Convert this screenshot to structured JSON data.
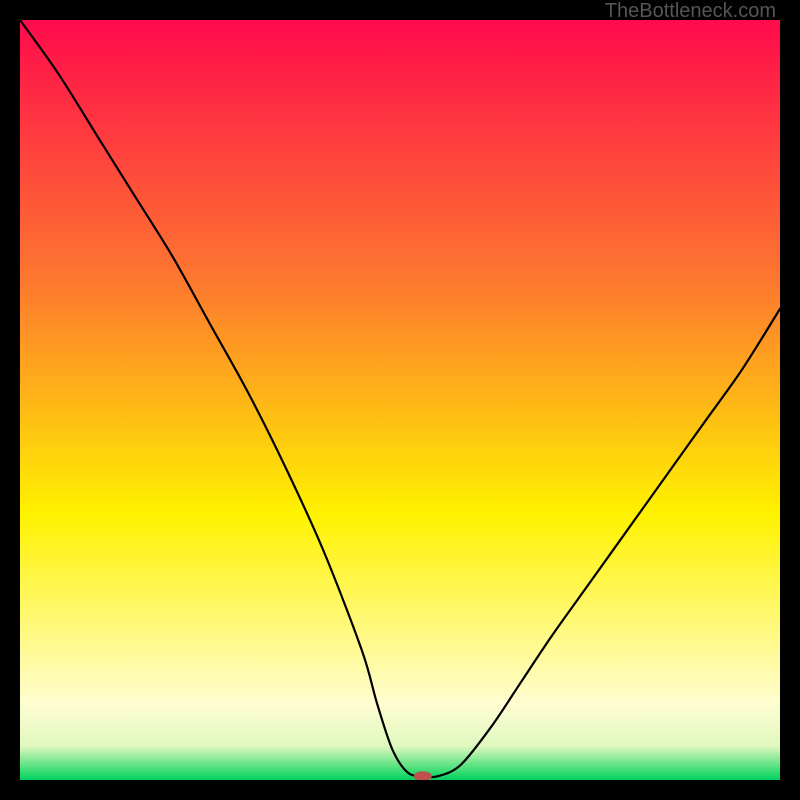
{
  "watermark": "TheBottleneck.com",
  "chart_data": {
    "type": "line",
    "title": "",
    "xlabel": "",
    "ylabel": "",
    "xlim": [
      0,
      100
    ],
    "ylim": [
      0,
      100
    ],
    "grid": false,
    "legend": false,
    "background_gradient": {
      "stops": [
        {
          "offset": 0.0,
          "color": "#ff0b4c"
        },
        {
          "offset": 0.35,
          "color": "#fd7a2e"
        },
        {
          "offset": 0.65,
          "color": "#fff200"
        },
        {
          "offset": 0.9,
          "color": "#fffdd0"
        },
        {
          "offset": 0.955,
          "color": "#e0f8c0"
        },
        {
          "offset": 0.985,
          "color": "#4be07a"
        },
        {
          "offset": 1.0,
          "color": "#00d060"
        }
      ]
    },
    "series": [
      {
        "name": "bottleneck-curve",
        "color": "#000000",
        "width": 2.2,
        "x": [
          0,
          5,
          10,
          15,
          20,
          25,
          30,
          35,
          40,
          45,
          47,
          49,
          51,
          53,
          55,
          58,
          62,
          66,
          70,
          75,
          80,
          85,
          90,
          95,
          100
        ],
        "y": [
          100,
          93,
          85,
          77,
          69,
          60,
          51,
          41,
          30,
          17,
          10,
          4,
          1,
          0.5,
          0.5,
          2,
          7,
          13,
          19,
          26,
          33,
          40,
          47,
          54,
          62
        ]
      }
    ],
    "marker": {
      "name": "optimal-point",
      "x": 53,
      "y": 0.5,
      "color": "#c05050",
      "rx": 9,
      "ry": 5
    }
  }
}
